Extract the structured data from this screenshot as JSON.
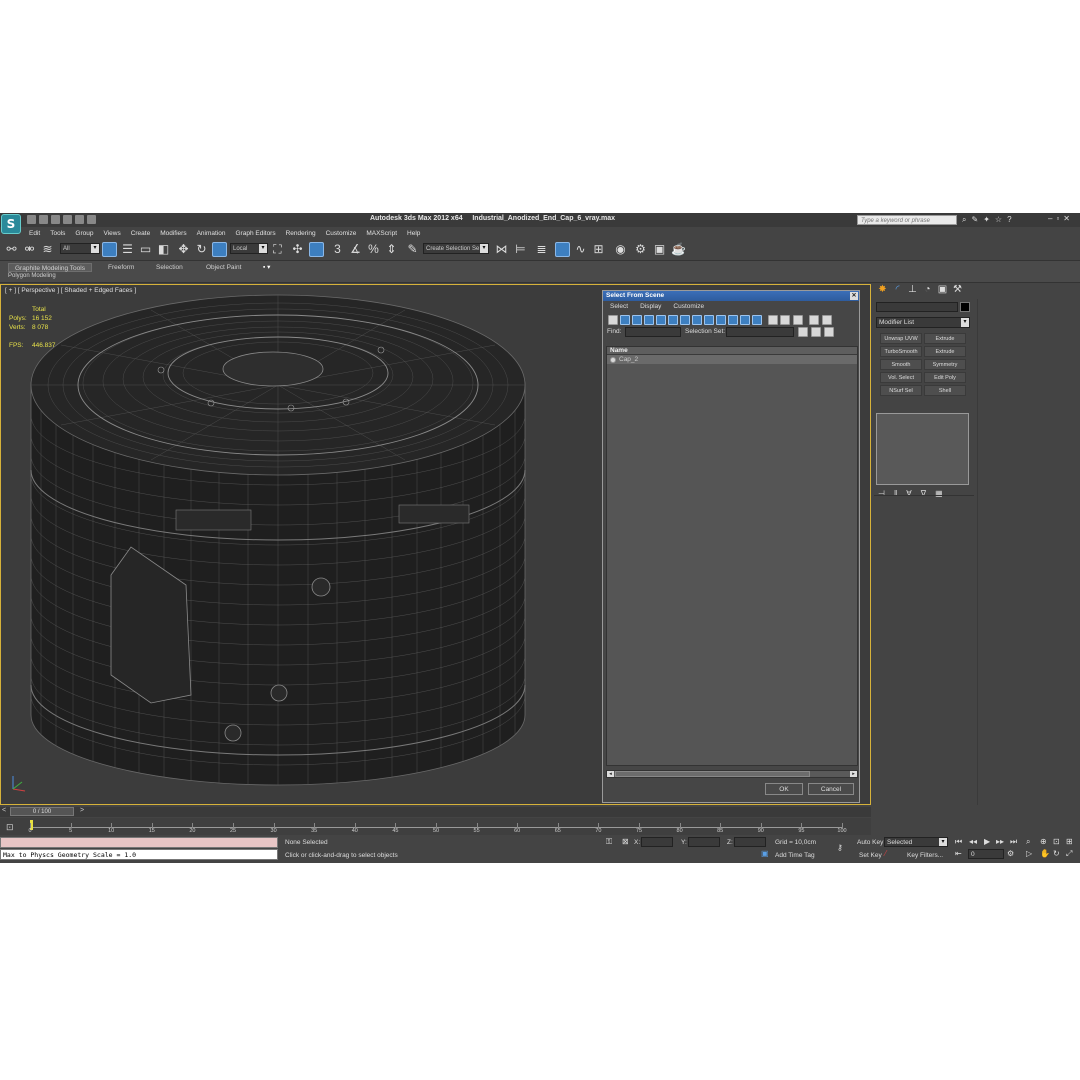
{
  "app": {
    "title_left": "Autodesk 3ds Max  2012 x64",
    "title_file": "Industrial_Anodized_End_Cap_6_vray.max",
    "search_placeholder": "Type a keyword or phrase",
    "logo_glyph": "S"
  },
  "menu": [
    "Edit",
    "Tools",
    "Group",
    "Views",
    "Create",
    "Modifiers",
    "Animation",
    "Graph Editors",
    "Rendering",
    "Customize",
    "MAXScript",
    "Help"
  ],
  "toolbar": {
    "filter_value": "All",
    "coord_value": "Local",
    "selection_set_value": "Create Selection Se"
  },
  "ribbon": {
    "tabs": [
      "Graphite Modeling Tools",
      "Freeform",
      "Selection",
      "Object Paint"
    ],
    "sub_label": "Polygon Modeling"
  },
  "viewport": {
    "label": "[ + ] [ Perspective ] [ Shaded + Edged Faces ]",
    "stats": {
      "header": "Total",
      "polys_label": "Polys:",
      "polys_value": "16 152",
      "verts_label": "Verts:",
      "verts_value": "8 078",
      "fps_label": "FPS:",
      "fps_value": "446.837"
    }
  },
  "dialog": {
    "title": "Select From Scene",
    "menu": [
      "Select",
      "Display",
      "Customize"
    ],
    "find_label": "Find:",
    "selection_set_label": "Selection Set:",
    "column_name": "Name",
    "items": [
      "Cap_2"
    ],
    "ok_label": "OK",
    "cancel_label": "Cancel"
  },
  "command_panel": {
    "modifier_list": "Modifier List",
    "modifiers": [
      "Unwrap UVW",
      "Extrude",
      "TurboSmooth",
      "Extrude",
      "Smooth",
      "Symmetry",
      "Vol. Select",
      "Edit Poly",
      "NSurf Sel",
      "Shell"
    ]
  },
  "timeline": {
    "slider_label": "0 / 100",
    "ticks": [
      "0",
      "5",
      "10",
      "15",
      "20",
      "25",
      "30",
      "35",
      "40",
      "45",
      "50",
      "55",
      "60",
      "65",
      "70",
      "75",
      "80",
      "85",
      "90",
      "95",
      "100"
    ]
  },
  "status": {
    "script_output": "Max to Physcs Geometry Scale = 1.0",
    "selection_text": "None Selected",
    "prompt_text": "Click or click-and-drag to select objects",
    "x_label": "X:",
    "y_label": "Y:",
    "z_label": "Z:",
    "grid_text": "Grid = 10,0cm",
    "add_time_tag": "Add Time Tag",
    "auto_key": "Auto Key",
    "set_key": "Set Key",
    "selected_value": "Selected",
    "key_filters": "Key Filters...",
    "frame_value": "0"
  },
  "colors": {
    "viewport_bg": "#3c3c3c",
    "viewport_border": "#d6b23a",
    "stats_text": "#e8e24a",
    "dialog_title": "#2e5c9e",
    "accent_blue": "#3d7fc0"
  }
}
